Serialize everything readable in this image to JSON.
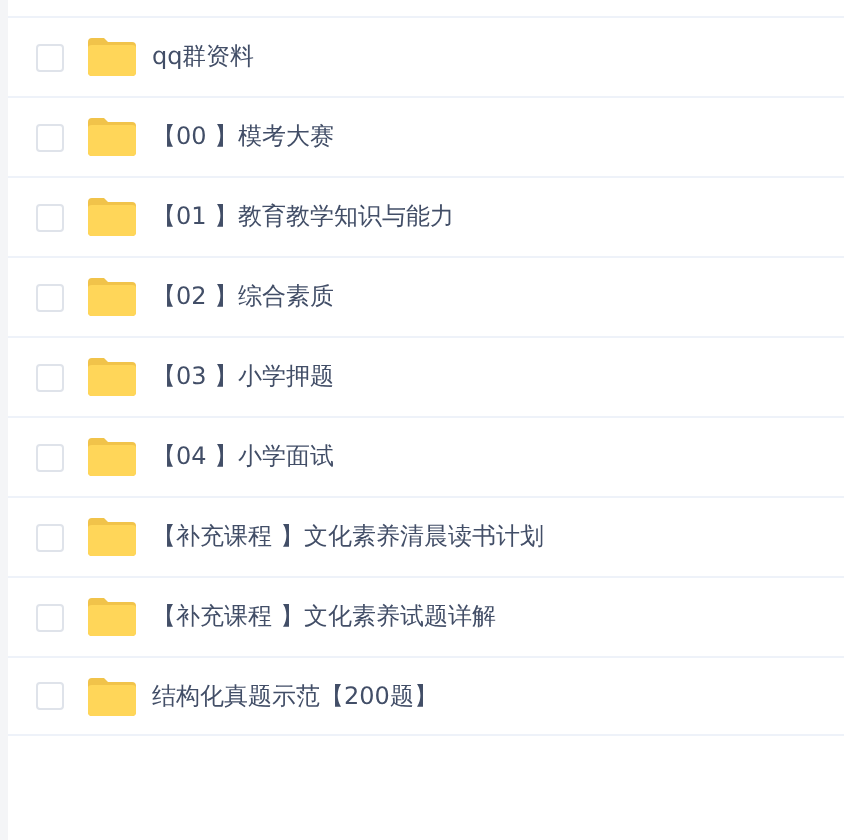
{
  "files": [
    {
      "name": "qq群资料",
      "checked": false
    },
    {
      "name": "【00 】模考大赛",
      "checked": false
    },
    {
      "name": "【01 】教育教学知识与能力",
      "checked": false
    },
    {
      "name": "【02 】综合素质",
      "checked": false
    },
    {
      "name": "【03 】小学押题",
      "checked": false
    },
    {
      "name": "【04 】小学面试",
      "checked": false
    },
    {
      "name": "【补充课程 】文化素养清晨读书计划",
      "checked": false
    },
    {
      "name": "【补充课程 】文化素养试题详解",
      "checked": false
    },
    {
      "name": "结构化真题示范【200题】",
      "checked": false
    }
  ]
}
